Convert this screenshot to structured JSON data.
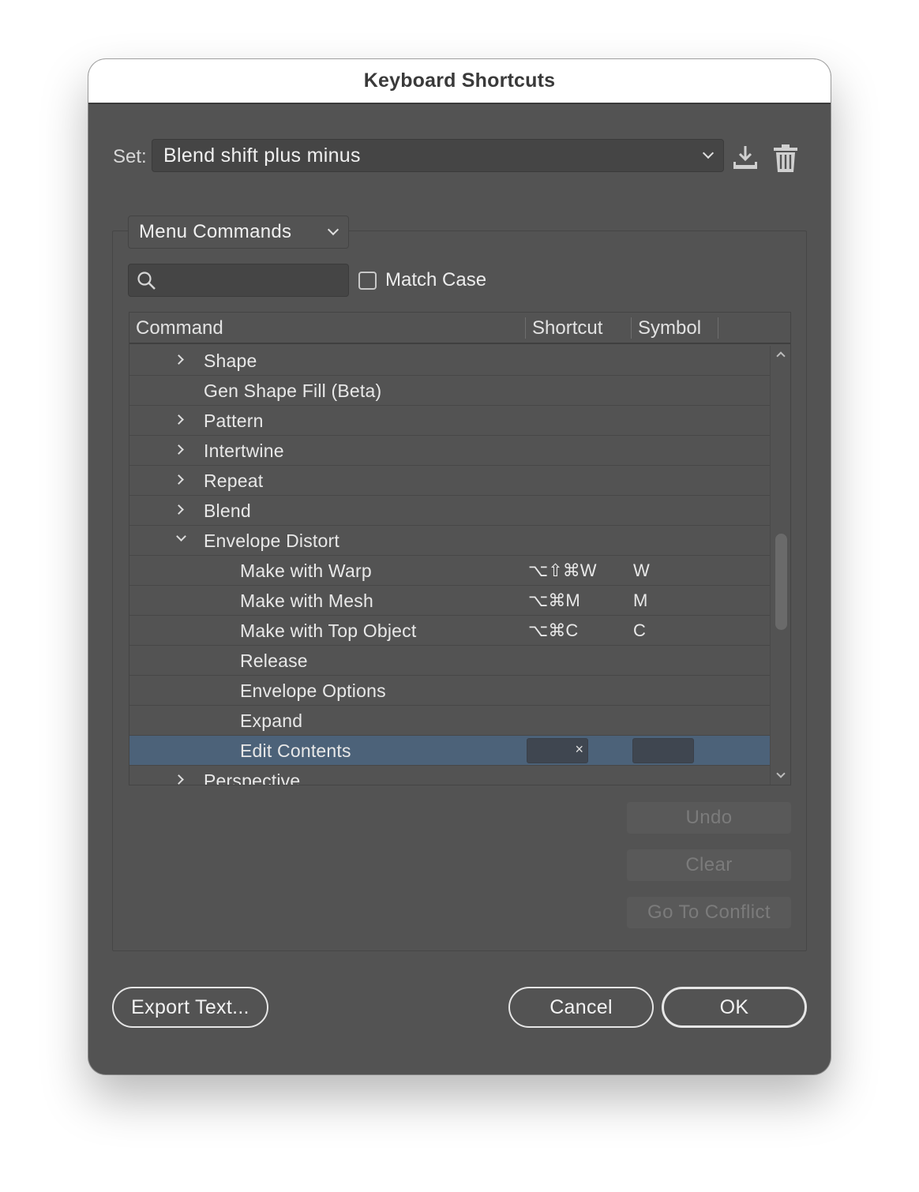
{
  "window": {
    "title": "Keyboard Shortcuts"
  },
  "set": {
    "label": "Set:",
    "value": "Blend shift plus minus",
    "icons": [
      "save-set-icon",
      "delete-set-icon"
    ]
  },
  "category": {
    "value": "Menu Commands"
  },
  "search": {
    "placeholder": "",
    "value": ""
  },
  "match_case": {
    "label": "Match Case",
    "checked": false
  },
  "table": {
    "columns": [
      "Command",
      "Shortcut",
      "Symbol"
    ],
    "rows": [
      {
        "name": "Shape",
        "level": 1,
        "disclosure": "collapsed",
        "shortcut": "",
        "symbol": ""
      },
      {
        "name": "Gen Shape Fill (Beta)",
        "level": 1,
        "disclosure": "none",
        "shortcut": "",
        "symbol": ""
      },
      {
        "name": "Pattern",
        "level": 1,
        "disclosure": "collapsed",
        "shortcut": "",
        "symbol": ""
      },
      {
        "name": "Intertwine",
        "level": 1,
        "disclosure": "collapsed",
        "shortcut": "",
        "symbol": ""
      },
      {
        "name": "Repeat",
        "level": 1,
        "disclosure": "collapsed",
        "shortcut": "",
        "symbol": ""
      },
      {
        "name": "Blend",
        "level": 1,
        "disclosure": "collapsed",
        "shortcut": "",
        "symbol": ""
      },
      {
        "name": "Envelope Distort",
        "level": 1,
        "disclosure": "expanded",
        "shortcut": "",
        "symbol": ""
      },
      {
        "name": "Make with Warp",
        "level": 2,
        "disclosure": "none",
        "shortcut": "⌥⇧⌘W",
        "symbol": "W"
      },
      {
        "name": "Make with Mesh",
        "level": 2,
        "disclosure": "none",
        "shortcut": "⌥⌘M",
        "symbol": "M"
      },
      {
        "name": "Make with Top Object",
        "level": 2,
        "disclosure": "none",
        "shortcut": "⌥⌘C",
        "symbol": "C"
      },
      {
        "name": "Release",
        "level": 2,
        "disclosure": "none",
        "shortcut": "",
        "symbol": ""
      },
      {
        "name": "Envelope Options",
        "level": 2,
        "disclosure": "none",
        "shortcut": "",
        "symbol": ""
      },
      {
        "name": "Expand",
        "level": 2,
        "disclosure": "none",
        "shortcut": "",
        "symbol": ""
      },
      {
        "name": "Edit Contents",
        "level": 2,
        "disclosure": "none",
        "shortcut": "",
        "symbol": "",
        "selected": true,
        "editing": true
      },
      {
        "name": "Perspective",
        "level": 1,
        "disclosure": "collapsed",
        "shortcut": "",
        "symbol": ""
      }
    ],
    "clear_field_glyph": "×",
    "scroll_position": 0.55
  },
  "side_buttons": {
    "undo": "Undo",
    "clear": "Clear",
    "go_to_conflict": "Go To Conflict"
  },
  "footer": {
    "export": "Export Text...",
    "cancel": "Cancel",
    "ok": "OK"
  },
  "colors": {
    "dialog_bg": "#535353",
    "selection": "#4c6279",
    "titlebar": "#ffffff"
  }
}
